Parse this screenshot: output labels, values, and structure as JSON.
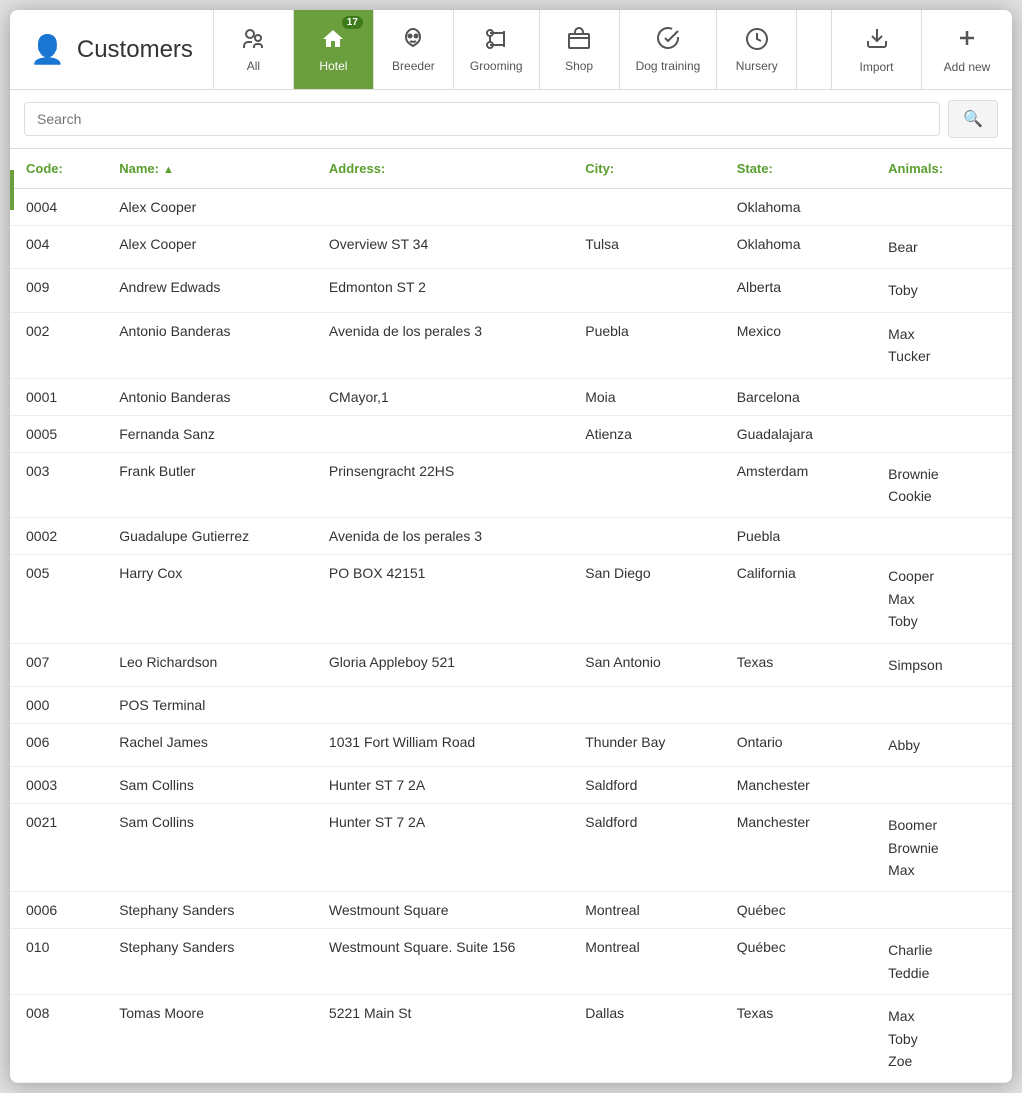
{
  "header": {
    "title": "Customers",
    "title_icon": "👤"
  },
  "tabs": [
    {
      "id": "all",
      "label": "All",
      "icon": "👥",
      "active": false,
      "badge": null
    },
    {
      "id": "hotel",
      "label": "Hotel",
      "icon": "🏠",
      "active": true,
      "badge": "17"
    },
    {
      "id": "breeder",
      "label": "Breeder",
      "icon": "🐱",
      "active": false,
      "badge": null
    },
    {
      "id": "grooming",
      "label": "Grooming",
      "icon": "✂️",
      "active": false,
      "badge": null
    },
    {
      "id": "shop",
      "label": "Shop",
      "icon": "🛒",
      "active": false,
      "badge": null
    },
    {
      "id": "dog-training",
      "label": "Dog training",
      "icon": "🎓",
      "active": false,
      "badge": null
    },
    {
      "id": "nursery",
      "label": "Nursery",
      "icon": "⏱️",
      "active": false,
      "badge": null
    }
  ],
  "actions": [
    {
      "id": "import",
      "label": "Import",
      "icon": "⬇"
    },
    {
      "id": "add-new",
      "label": "Add new",
      "icon": "+"
    }
  ],
  "search": {
    "placeholder": "Search",
    "value": ""
  },
  "table": {
    "columns": [
      {
        "id": "code",
        "label": "Code:"
      },
      {
        "id": "name",
        "label": "Name:",
        "sortable": true,
        "sort": "asc"
      },
      {
        "id": "address",
        "label": "Address:"
      },
      {
        "id": "city",
        "label": "City:"
      },
      {
        "id": "state",
        "label": "State:"
      },
      {
        "id": "animals",
        "label": "Animals:"
      }
    ],
    "rows": [
      {
        "code": "0004",
        "name": "Alex Cooper",
        "address": "",
        "city": "",
        "state": "Oklahoma",
        "animals": ""
      },
      {
        "code": "004",
        "name": "Alex Cooper",
        "address": "Overview ST 34",
        "city": "Tulsa",
        "state": "Oklahoma",
        "animals": "Bear"
      },
      {
        "code": "009",
        "name": "Andrew Edwads",
        "address": "Edmonton ST 2",
        "city": "",
        "state": "Alberta",
        "animals": "Toby"
      },
      {
        "code": "002",
        "name": "Antonio Banderas",
        "address": "Avenida de los perales 3",
        "city": "Puebla",
        "state": "Mexico",
        "animals": "Max\nTucker"
      },
      {
        "code": "0001",
        "name": "Antonio Banderas",
        "address": "CMayor,1",
        "city": "Moia",
        "state": "Barcelona",
        "animals": ""
      },
      {
        "code": "0005",
        "name": "Fernanda Sanz",
        "address": "",
        "city": "Atienza",
        "state": "Guadalajara",
        "animals": ""
      },
      {
        "code": "003",
        "name": "Frank Butler",
        "address": "Prinsengracht 22HS",
        "city": "",
        "state": "Amsterdam",
        "animals": "Brownie\nCookie"
      },
      {
        "code": "0002",
        "name": "Guadalupe Gutierrez",
        "address": "Avenida de los perales 3",
        "city": "",
        "state": "Puebla",
        "animals": ""
      },
      {
        "code": "005",
        "name": "Harry Cox",
        "address": "PO BOX 42151",
        "city": "San Diego",
        "state": "California",
        "animals": "Cooper\nMax\nToby"
      },
      {
        "code": "007",
        "name": "Leo Richardson",
        "address": "Gloria Appleboy 521",
        "city": "San Antonio",
        "state": "Texas",
        "animals": "Simpson"
      },
      {
        "code": "000",
        "name": "POS Terminal",
        "address": "",
        "city": "",
        "state": "",
        "animals": ""
      },
      {
        "code": "006",
        "name": "Rachel James",
        "address": "1031 Fort William Road",
        "city": "Thunder Bay",
        "state": "Ontario",
        "animals": "Abby"
      },
      {
        "code": "0003",
        "name": "Sam Collins",
        "address": "Hunter ST 7 2A",
        "city": "Saldford",
        "state": "Manchester",
        "animals": ""
      },
      {
        "code": "0021",
        "name": "Sam Collins",
        "address": "Hunter ST 7 2A",
        "city": "Saldford",
        "state": "Manchester",
        "animals": "Boomer\nBrownie\nMax"
      },
      {
        "code": "0006",
        "name": "Stephany Sanders",
        "address": "Westmount Square",
        "city": "Montreal",
        "state": "Québec",
        "animals": ""
      },
      {
        "code": "010",
        "name": "Stephany Sanders",
        "address": "Westmount Square. Suite 156",
        "city": "Montreal",
        "state": "Québec",
        "animals": "Charlie\nTeddie"
      },
      {
        "code": "008",
        "name": "Tomas Moore",
        "address": "5221 Main St",
        "city": "Dallas",
        "state": "Texas",
        "animals": "Max\nToby\nZoe"
      }
    ]
  }
}
